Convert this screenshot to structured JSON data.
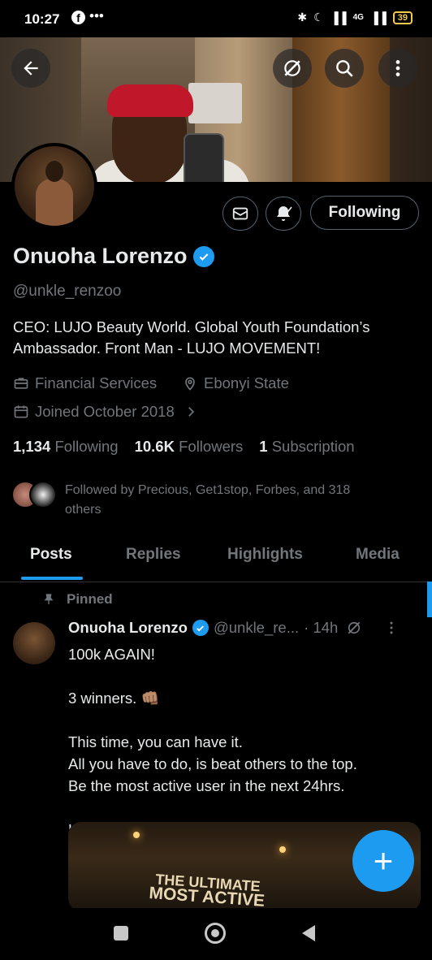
{
  "status_bar": {
    "time": "10:27",
    "facebook_glyph": "f",
    "more": "•••",
    "signal_4g": "4G",
    "battery": "39"
  },
  "header": {
    "back_icon": "back-arrow-icon",
    "buttons": [
      "grok-icon",
      "search-icon",
      "more-vertical-icon"
    ]
  },
  "profile": {
    "name": "Onuoha Lorenzo",
    "handle": "@unkle_renzoo",
    "bio": "CEO: LUJO Beauty World. Global Youth Foundation’s Ambassador. Front Man - LUJO MOVEMENT!",
    "category": "Financial Services",
    "location": "Ebonyi State",
    "joined": "Joined October 2018",
    "following_button": "Following",
    "stats": {
      "following_count": "1,134",
      "following_label": "Following",
      "followers_count": "10.6K",
      "followers_label": "Followers",
      "subscription_count": "1",
      "subscription_label": "Subscription"
    },
    "followed_by": "Followed by Precious, Get1stop, Forbes, and 318 others"
  },
  "tabs": [
    "Posts",
    "Replies",
    "Highlights",
    "Media"
  ],
  "active_tab": "Posts",
  "post": {
    "pinned_label": "Pinned",
    "author_name": "Onuoha Lorenzo",
    "author_handle": "@unkle_re...",
    "time": "· 14h",
    "body": "100k AGAIN!\n\n3 winners. 👊🏽\n\nThis time, you can have it.\nAll you have to do, is beat others to the top.\nBe the most active user in the next 24hrs.\n\nLet’s go 👊🏽👊🏽👊🏽",
    "media_caption_line1": "THE ULTIMATE",
    "media_caption_line2": "MOST ACTIVE"
  },
  "fab": "+",
  "colors": {
    "accent": "#1d9bf0",
    "text": "#e7e9ea",
    "muted": "#71767b",
    "bg": "#000000"
  }
}
